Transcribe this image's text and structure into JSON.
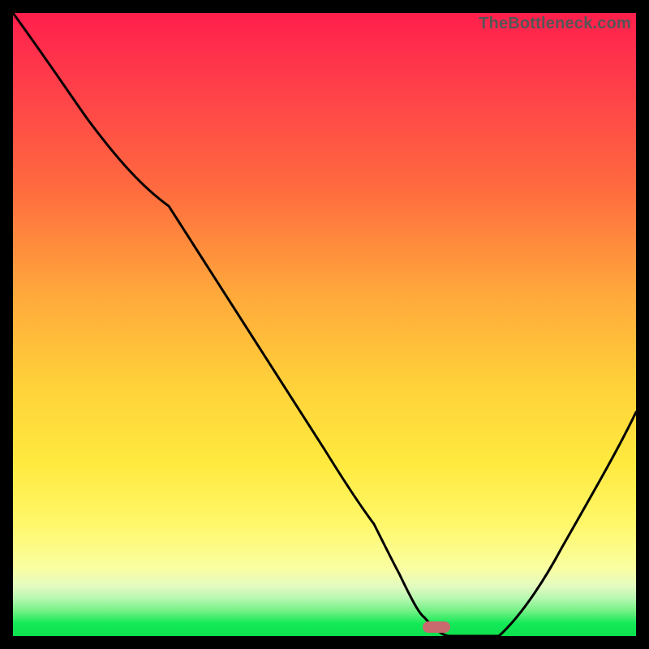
{
  "watermark": "TheBottleneck.com",
  "chart_data": {
    "type": "line",
    "title": "",
    "xlabel": "",
    "ylabel": "",
    "xlim": [
      0,
      100
    ],
    "ylim": [
      0,
      100
    ],
    "grid": false,
    "series": [
      {
        "name": "bottleneck-curve",
        "x": [
          0,
          12,
          24,
          25,
          50,
          58,
          62,
          66,
          70,
          78,
          88,
          100
        ],
        "values": [
          100,
          83,
          70,
          69,
          30,
          18,
          10,
          3,
          0,
          0,
          14,
          36
        ]
      }
    ],
    "optimal_marker": {
      "x": 68,
      "y": 0
    },
    "gradient_stops": [
      {
        "pct": 0,
        "color": "#ff1f4c"
      },
      {
        "pct": 50,
        "color": "#ffb53b"
      },
      {
        "pct": 80,
        "color": "#fff550"
      },
      {
        "pct": 95,
        "color": "#a7f5a0"
      },
      {
        "pct": 100,
        "color": "#0ee04e"
      }
    ]
  }
}
